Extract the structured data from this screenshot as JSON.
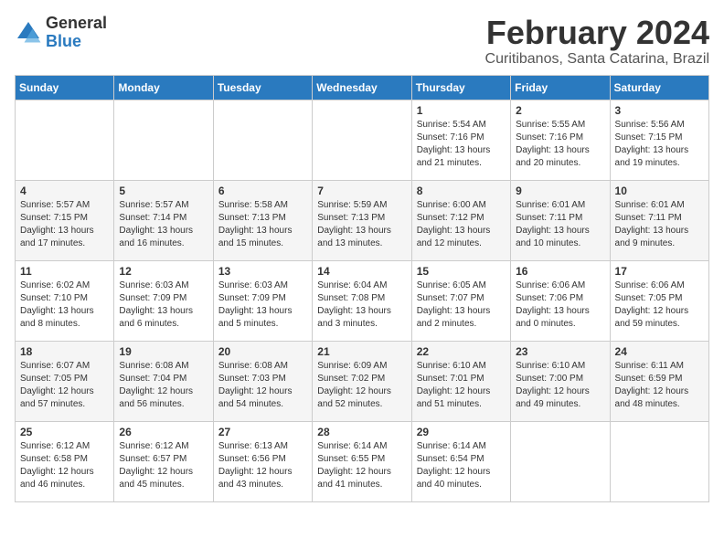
{
  "header": {
    "logo_general": "General",
    "logo_blue": "Blue",
    "month_title": "February 2024",
    "location": "Curitibanos, Santa Catarina, Brazil"
  },
  "days_of_week": [
    "Sunday",
    "Monday",
    "Tuesday",
    "Wednesday",
    "Thursday",
    "Friday",
    "Saturday"
  ],
  "weeks": [
    [
      {
        "day": "",
        "info": ""
      },
      {
        "day": "",
        "info": ""
      },
      {
        "day": "",
        "info": ""
      },
      {
        "day": "",
        "info": ""
      },
      {
        "day": "1",
        "info": "Sunrise: 5:54 AM\nSunset: 7:16 PM\nDaylight: 13 hours\nand 21 minutes."
      },
      {
        "day": "2",
        "info": "Sunrise: 5:55 AM\nSunset: 7:16 PM\nDaylight: 13 hours\nand 20 minutes."
      },
      {
        "day": "3",
        "info": "Sunrise: 5:56 AM\nSunset: 7:15 PM\nDaylight: 13 hours\nand 19 minutes."
      }
    ],
    [
      {
        "day": "4",
        "info": "Sunrise: 5:57 AM\nSunset: 7:15 PM\nDaylight: 13 hours\nand 17 minutes."
      },
      {
        "day": "5",
        "info": "Sunrise: 5:57 AM\nSunset: 7:14 PM\nDaylight: 13 hours\nand 16 minutes."
      },
      {
        "day": "6",
        "info": "Sunrise: 5:58 AM\nSunset: 7:13 PM\nDaylight: 13 hours\nand 15 minutes."
      },
      {
        "day": "7",
        "info": "Sunrise: 5:59 AM\nSunset: 7:13 PM\nDaylight: 13 hours\nand 13 minutes."
      },
      {
        "day": "8",
        "info": "Sunrise: 6:00 AM\nSunset: 7:12 PM\nDaylight: 13 hours\nand 12 minutes."
      },
      {
        "day": "9",
        "info": "Sunrise: 6:01 AM\nSunset: 7:11 PM\nDaylight: 13 hours\nand 10 minutes."
      },
      {
        "day": "10",
        "info": "Sunrise: 6:01 AM\nSunset: 7:11 PM\nDaylight: 13 hours\nand 9 minutes."
      }
    ],
    [
      {
        "day": "11",
        "info": "Sunrise: 6:02 AM\nSunset: 7:10 PM\nDaylight: 13 hours\nand 8 minutes."
      },
      {
        "day": "12",
        "info": "Sunrise: 6:03 AM\nSunset: 7:09 PM\nDaylight: 13 hours\nand 6 minutes."
      },
      {
        "day": "13",
        "info": "Sunrise: 6:03 AM\nSunset: 7:09 PM\nDaylight: 13 hours\nand 5 minutes."
      },
      {
        "day": "14",
        "info": "Sunrise: 6:04 AM\nSunset: 7:08 PM\nDaylight: 13 hours\nand 3 minutes."
      },
      {
        "day": "15",
        "info": "Sunrise: 6:05 AM\nSunset: 7:07 PM\nDaylight: 13 hours\nand 2 minutes."
      },
      {
        "day": "16",
        "info": "Sunrise: 6:06 AM\nSunset: 7:06 PM\nDaylight: 13 hours\nand 0 minutes."
      },
      {
        "day": "17",
        "info": "Sunrise: 6:06 AM\nSunset: 7:05 PM\nDaylight: 12 hours\nand 59 minutes."
      }
    ],
    [
      {
        "day": "18",
        "info": "Sunrise: 6:07 AM\nSunset: 7:05 PM\nDaylight: 12 hours\nand 57 minutes."
      },
      {
        "day": "19",
        "info": "Sunrise: 6:08 AM\nSunset: 7:04 PM\nDaylight: 12 hours\nand 56 minutes."
      },
      {
        "day": "20",
        "info": "Sunrise: 6:08 AM\nSunset: 7:03 PM\nDaylight: 12 hours\nand 54 minutes."
      },
      {
        "day": "21",
        "info": "Sunrise: 6:09 AM\nSunset: 7:02 PM\nDaylight: 12 hours\nand 52 minutes."
      },
      {
        "day": "22",
        "info": "Sunrise: 6:10 AM\nSunset: 7:01 PM\nDaylight: 12 hours\nand 51 minutes."
      },
      {
        "day": "23",
        "info": "Sunrise: 6:10 AM\nSunset: 7:00 PM\nDaylight: 12 hours\nand 49 minutes."
      },
      {
        "day": "24",
        "info": "Sunrise: 6:11 AM\nSunset: 6:59 PM\nDaylight: 12 hours\nand 48 minutes."
      }
    ],
    [
      {
        "day": "25",
        "info": "Sunrise: 6:12 AM\nSunset: 6:58 PM\nDaylight: 12 hours\nand 46 minutes."
      },
      {
        "day": "26",
        "info": "Sunrise: 6:12 AM\nSunset: 6:57 PM\nDaylight: 12 hours\nand 45 minutes."
      },
      {
        "day": "27",
        "info": "Sunrise: 6:13 AM\nSunset: 6:56 PM\nDaylight: 12 hours\nand 43 minutes."
      },
      {
        "day": "28",
        "info": "Sunrise: 6:14 AM\nSunset: 6:55 PM\nDaylight: 12 hours\nand 41 minutes."
      },
      {
        "day": "29",
        "info": "Sunrise: 6:14 AM\nSunset: 6:54 PM\nDaylight: 12 hours\nand 40 minutes."
      },
      {
        "day": "",
        "info": ""
      },
      {
        "day": "",
        "info": ""
      }
    ]
  ]
}
